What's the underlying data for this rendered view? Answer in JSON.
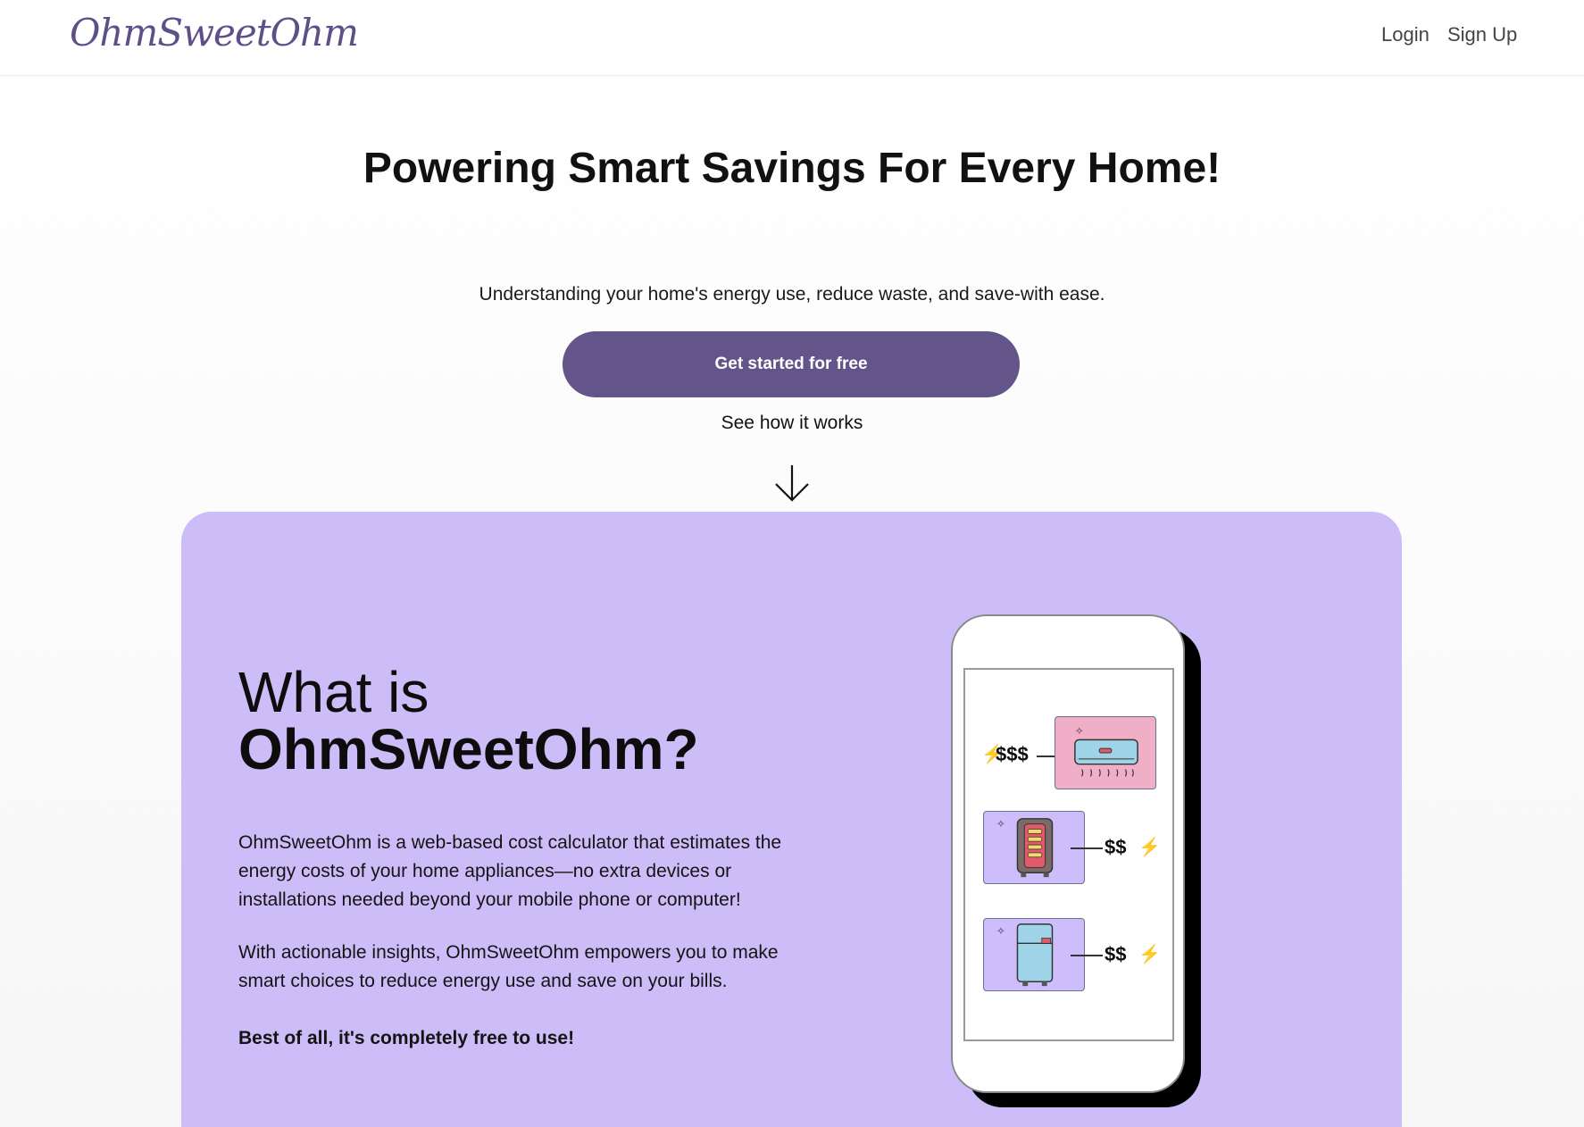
{
  "header": {
    "logo_text": "OhmSweetOhm",
    "nav": {
      "login": "Login",
      "signup": "Sign Up"
    }
  },
  "hero": {
    "title": "Powering Smart Savings For Every Home!",
    "subtitle": "Understanding your home's energy use, reduce waste, and save-with ease.",
    "cta_label": "Get started for free",
    "how_link": "See how it works"
  },
  "about": {
    "title_line1": "What is",
    "title_line2": "OhmSweetOhm?",
    "paragraph1": "OhmSweetOhm is a web-based cost calculator that estimates the energy costs of your home appliances—no extra devices or installations needed beyond your mobile phone or computer!",
    "paragraph2": "With actionable insights, OhmSweetOhm empowers you to make smart choices to reduce energy use and save on your bills.",
    "paragraph3": "Best of all, it's completely free to use!"
  },
  "phone_illustration": {
    "items": [
      {
        "icon": "air-conditioner-icon",
        "cost": "$$$"
      },
      {
        "icon": "space-heater-icon",
        "cost": "$$"
      },
      {
        "icon": "refrigerator-icon",
        "cost": "$$"
      }
    ]
  },
  "colors": {
    "brand": "#63558a",
    "logo": "#5e4f88",
    "panel": "#ccbcf8",
    "tile_pink": "#f0afc6",
    "tile_purple": "#cdbdfa",
    "bolt": "#f2d21b"
  }
}
